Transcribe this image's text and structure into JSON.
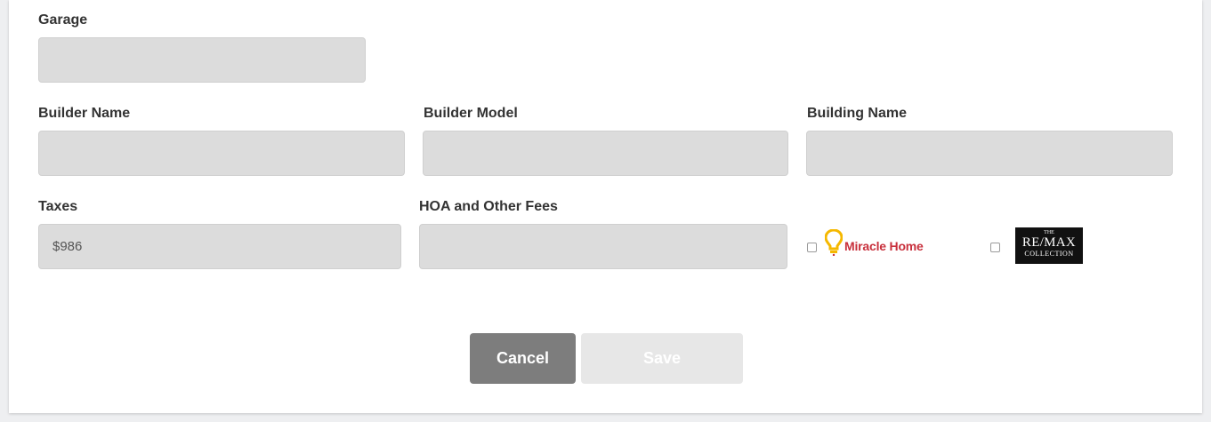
{
  "form": {
    "garage": {
      "label": "Garage",
      "value": ""
    },
    "builder_name": {
      "label": "Builder Name",
      "value": ""
    },
    "builder_model": {
      "label": "Builder Model",
      "value": ""
    },
    "building_name": {
      "label": "Building Name",
      "value": ""
    },
    "taxes": {
      "label": "Taxes",
      "value": "$986"
    },
    "hoa_fees": {
      "label": "HOA and Other Fees",
      "value": ""
    }
  },
  "brands": {
    "miracle_home": {
      "text": "Miracle Home",
      "checked": false,
      "color": "#c8303c",
      "icon_color": "#f5b800"
    },
    "remax_collection": {
      "line1": "THE",
      "line2": "RE/MAX",
      "line3": "COLLECTION",
      "checked": false
    }
  },
  "actions": {
    "cancel_label": "Cancel",
    "save_label": "Save"
  }
}
